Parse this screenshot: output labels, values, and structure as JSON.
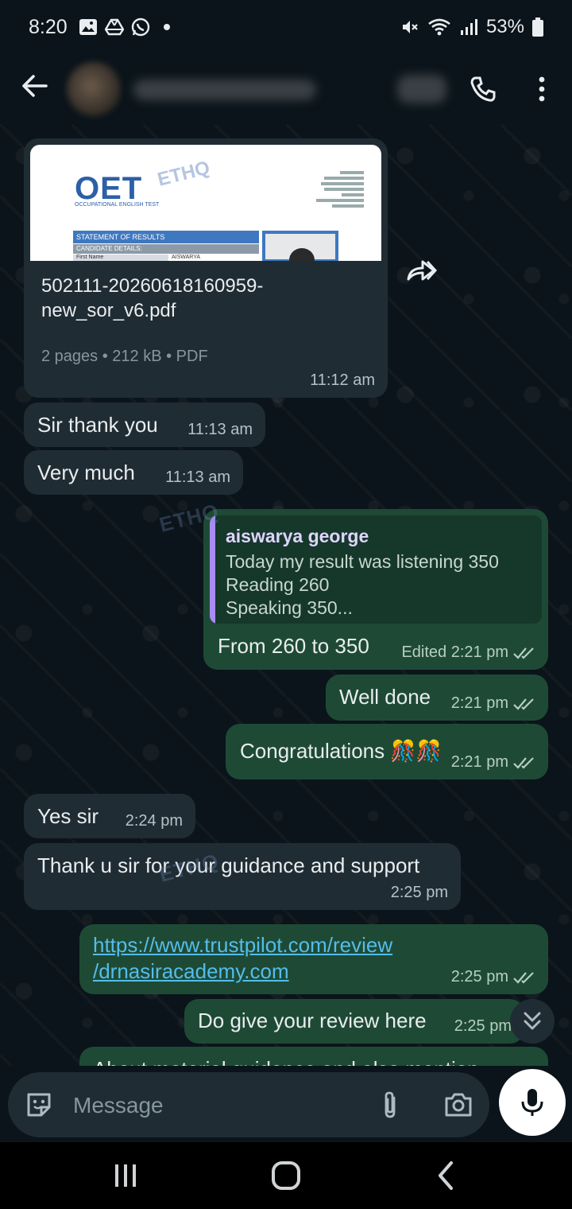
{
  "status_bar": {
    "time": "8:20",
    "battery": "53%"
  },
  "header": {
    "back_icon": "arrow-left-icon",
    "call_icon": "phone-icon",
    "menu_icon": "more-vert-icon"
  },
  "messages": [
    {
      "type": "document",
      "direction": "in",
      "preview_text": {
        "logo": "OET",
        "logo_sub": "OCCUPATIONAL ENGLISH TEST",
        "statement": "STATEMENT OF RESULTS",
        "candidate": "CANDIDATE DETAILS:",
        "first_name": "First Name",
        "name_value": "AISWARYA"
      },
      "file_name": "502111-20260618160959-new_sor_v6.pdf",
      "file_info": "2 pages • 212 kB • PDF",
      "time": "11:12 am"
    },
    {
      "direction": "in",
      "text": "Sir thank you",
      "time": "11:13 am"
    },
    {
      "direction": "in",
      "text": "Very much",
      "time": "11:13 am"
    },
    {
      "direction": "out",
      "reply_to": {
        "name": "aiswarya george",
        "text": "Today my result was listening 350\nReading 260\nSpeaking 350..."
      },
      "text": "From 260 to 350",
      "time": "Edited 2:21 pm"
    },
    {
      "direction": "out",
      "text": "Well done",
      "time": "2:21 pm"
    },
    {
      "direction": "out",
      "text": "Congratulations 🎊🎊",
      "time": "2:21 pm"
    },
    {
      "direction": "in",
      "text": "Yes sir",
      "time": "2:24 pm"
    },
    {
      "direction": "in",
      "text": "Thank u sir for your guidance and support",
      "time": "2:25 pm"
    },
    {
      "direction": "out",
      "text": "https://www.trustpilot.com/review\n/drnasiracademy.com",
      "time": "2:25 pm"
    },
    {
      "direction": "out",
      "text": "Do give your review here",
      "time": "2:25 pm"
    },
    {
      "direction": "out",
      "text": "About material guidance and also mention",
      "time": ""
    }
  ],
  "watermark": "ETHQ",
  "input": {
    "placeholder": "Message"
  }
}
